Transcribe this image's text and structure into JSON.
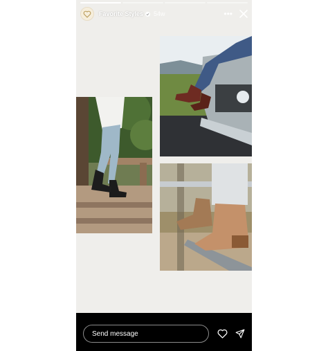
{
  "story": {
    "username": "Favorite Styles",
    "time_ago": "54w",
    "verified": true,
    "progress_segments": [
      1,
      0,
      0,
      0
    ],
    "avatar_icon": "heart-outline-icon",
    "more_icon": "more-horizontal-icon",
    "close_icon": "close-icon"
  },
  "photos": [
    {
      "subject": "woman-in-light-jeans-black-ankle-boots-on-wooden-steps"
    },
    {
      "subject": "legs-in-jeans-brown-boots-sitting-on-vintage-truck"
    },
    {
      "subject": "two-pairs-of-tan-ankle-boots-on-fence"
    }
  ],
  "footer": {
    "message_placeholder": "Send message",
    "like_icon": "heart-icon",
    "send_icon": "send-icon"
  },
  "colors": {
    "story_background": "#efeeeb",
    "footer_background": "#000000",
    "text": "#ffffff"
  }
}
